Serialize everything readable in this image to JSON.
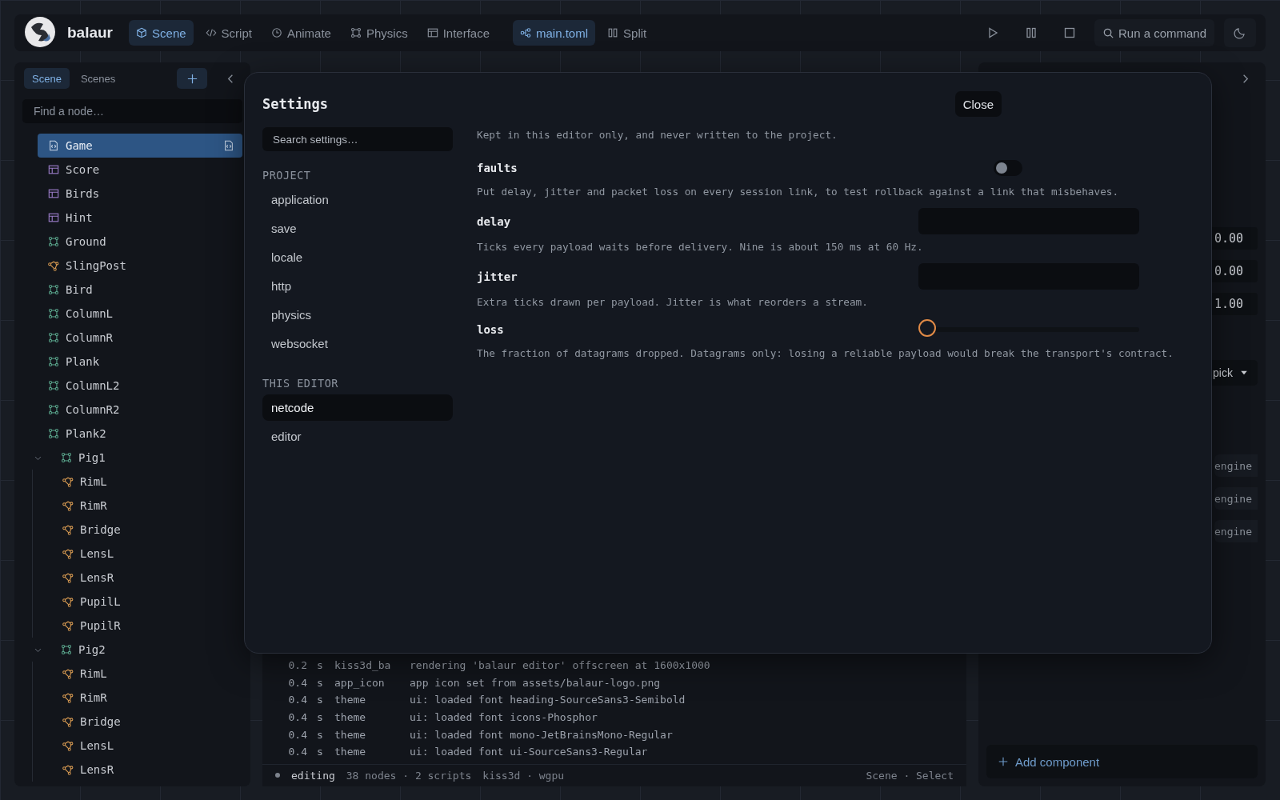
{
  "app": {
    "name": "balaur"
  },
  "toolbar": {
    "tabs": [
      {
        "label": "Scene",
        "selected": true
      },
      {
        "label": "Script",
        "selected": false
      },
      {
        "label": "Animate",
        "selected": false
      },
      {
        "label": "Physics",
        "selected": false
      },
      {
        "label": "Interface",
        "selected": false
      }
    ],
    "file": {
      "label": "main.toml"
    },
    "split": {
      "label": "Split"
    },
    "command": {
      "placeholder": "Run a command"
    }
  },
  "scene_panel": {
    "tabs": [
      {
        "label": "Scene",
        "selected": true
      },
      {
        "label": "Scenes",
        "selected": false
      }
    ],
    "search": {
      "placeholder": "Find a node…"
    },
    "nodes": [
      {
        "name": "Game",
        "kind": "script",
        "selected": true
      },
      {
        "name": "Score",
        "kind": "ui",
        "selected": false
      },
      {
        "name": "Birds",
        "kind": "ui",
        "selected": false
      },
      {
        "name": "Hint",
        "kind": "ui",
        "selected": false
      },
      {
        "name": "Ground",
        "kind": "body",
        "selected": false
      },
      {
        "name": "SlingPost",
        "kind": "joint",
        "selected": false
      },
      {
        "name": "Bird",
        "kind": "body",
        "selected": false
      },
      {
        "name": "ColumnL",
        "kind": "body",
        "selected": false
      },
      {
        "name": "ColumnR",
        "kind": "body",
        "selected": false
      },
      {
        "name": "Plank",
        "kind": "body",
        "selected": false
      },
      {
        "name": "ColumnL2",
        "kind": "body",
        "selected": false
      },
      {
        "name": "ColumnR2",
        "kind": "body",
        "selected": false
      },
      {
        "name": "Plank2",
        "kind": "body",
        "selected": false
      },
      {
        "name": "Pig1",
        "kind": "body",
        "selected": false,
        "expanded": true,
        "children": [
          {
            "name": "RimL",
            "kind": "joint",
            "selected": false
          },
          {
            "name": "RimR",
            "kind": "joint",
            "selected": false
          },
          {
            "name": "Bridge",
            "kind": "joint",
            "selected": false
          },
          {
            "name": "LensL",
            "kind": "joint",
            "selected": false
          },
          {
            "name": "LensR",
            "kind": "joint",
            "selected": false
          },
          {
            "name": "PupilL",
            "kind": "joint",
            "selected": false
          },
          {
            "name": "PupilR",
            "kind": "joint",
            "selected": false
          }
        ]
      },
      {
        "name": "Pig2",
        "kind": "body",
        "selected": false,
        "expanded": true,
        "children": [
          {
            "name": "RimL",
            "kind": "joint",
            "selected": false
          },
          {
            "name": "RimR",
            "kind": "joint",
            "selected": false
          },
          {
            "name": "Bridge",
            "kind": "joint",
            "selected": false
          },
          {
            "name": "LensL",
            "kind": "joint",
            "selected": false
          },
          {
            "name": "LensR",
            "kind": "joint",
            "selected": false
          }
        ]
      }
    ]
  },
  "settings": {
    "title": "Settings",
    "close": "Close",
    "search": {
      "placeholder": "Search settings…"
    },
    "sections": [
      {
        "heading": "PROJECT",
        "items": [
          {
            "label": "application",
            "selected": false
          },
          {
            "label": "save",
            "selected": false
          },
          {
            "label": "locale",
            "selected": false
          },
          {
            "label": "http",
            "selected": false
          },
          {
            "label": "physics",
            "selected": false
          },
          {
            "label": "websocket",
            "selected": false
          }
        ]
      },
      {
        "heading": "THIS EDITOR",
        "items": [
          {
            "label": "netcode",
            "selected": true
          },
          {
            "label": "editor",
            "selected": false
          }
        ]
      }
    ],
    "intro": "Kept in this editor only, and never written to the project.",
    "fields": [
      {
        "kind": "toggle",
        "name": "faults",
        "on": false,
        "description": "Put delay, jitter and packet loss on every session link, to test rollback against a link that misbehaves."
      },
      {
        "kind": "number",
        "name": "delay",
        "description": "Ticks every payload waits before delivery. Nine is about 150 ms at 60 Hz."
      },
      {
        "kind": "number",
        "name": "jitter",
        "description": "Extra ticks drawn per payload. Jitter is what reorders a stream."
      },
      {
        "kind": "slider",
        "name": "loss",
        "level": 0,
        "description": "The fraction of datagrams dropped. Datagrams only: losing a reliable payload would break the transport's contract."
      }
    ]
  },
  "log": {
    "rows": [
      {
        "time": "0.2",
        "unit": "s",
        "source": "kiss3d_ba",
        "message": "rendering 'balaur editor' offscreen at 1600x1000"
      },
      {
        "time": "0.4",
        "unit": "s",
        "source": "app_icon",
        "message": "app icon set from assets/balaur-logo.png"
      },
      {
        "time": "0.4",
        "unit": "s",
        "source": "theme",
        "message": "ui: loaded font heading-SourceSans3-Semibold"
      },
      {
        "time": "0.4",
        "unit": "s",
        "source": "theme",
        "message": "ui: loaded font icons-Phosphor"
      },
      {
        "time": "0.4",
        "unit": "s",
        "source": "theme",
        "message": "ui: loaded font mono-JetBrainsMono-Regular"
      },
      {
        "time": "0.4",
        "unit": "s",
        "source": "theme",
        "message": "ui: loaded font ui-SourceSans3-Regular"
      }
    ]
  },
  "status_bar": {
    "state": "editing",
    "counts": "38 nodes · 2 scripts",
    "backend": "kiss3d · wgpu",
    "mode": "Scene · Select"
  },
  "inspector": {
    "values": [
      "0.00",
      "0.00",
      "1.00"
    ],
    "dropdown": "pick",
    "engines": [
      "engine",
      "engine",
      "engine"
    ],
    "add_button": "Add component"
  }
}
